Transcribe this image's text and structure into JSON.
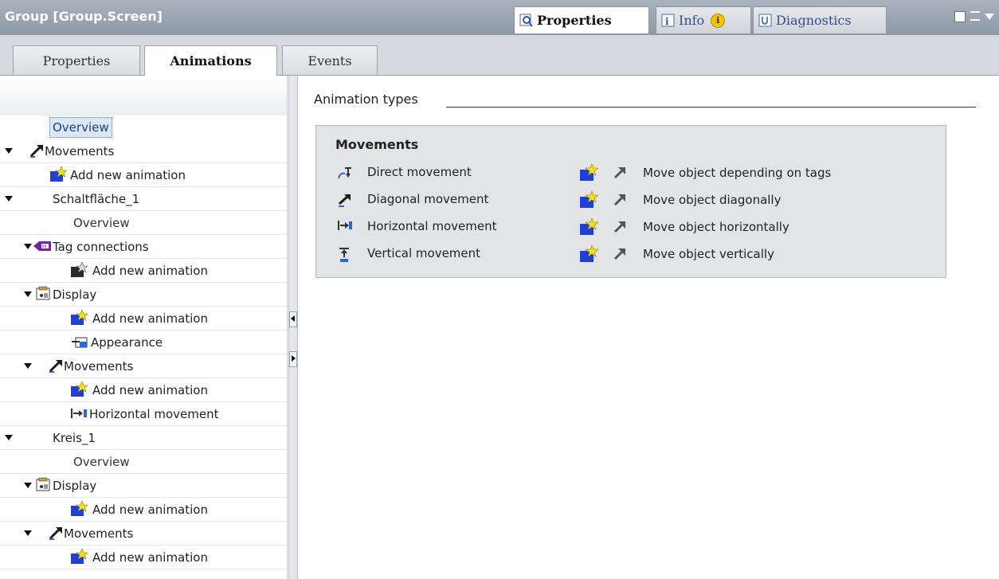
{
  "window": {
    "title": "Group [Group.Screen]",
    "tabs": [
      {
        "label": "Properties",
        "active": true
      },
      {
        "label": "Info",
        "active": false
      },
      {
        "label": "Diagnostics",
        "active": false
      }
    ]
  },
  "subtabs": [
    {
      "label": "Properties",
      "active": false
    },
    {
      "label": "Animations",
      "active": true
    },
    {
      "label": "Events",
      "active": false
    }
  ],
  "tree": {
    "items": [
      {
        "label": "Overview",
        "icon": "none",
        "level": 0,
        "selected": true
      },
      {
        "label": "Movements",
        "icon": "movement-icon",
        "level": 0,
        "expanded": true
      },
      {
        "label": "Add new animation",
        "icon": "add-animation-icon",
        "level": 1
      },
      {
        "label": "Schaltfläche_1",
        "icon": "none",
        "level": 0,
        "expanded": true
      },
      {
        "label": "Overview",
        "icon": "none",
        "level": 2
      },
      {
        "label": "Tag connections",
        "icon": "tag-connection-icon",
        "level": 1,
        "expanded": true
      },
      {
        "label": "Add new animation",
        "icon": "add-animation-icon",
        "level": 2
      },
      {
        "label": "Display",
        "icon": "display-icon",
        "level": 1,
        "expanded": true
      },
      {
        "label": "Add new animation",
        "icon": "add-animation-icon",
        "level": 2
      },
      {
        "label": "Appearance",
        "icon": "appearance-icon",
        "level": 2
      },
      {
        "label": "Movements",
        "icon": "movement-icon",
        "level": 1,
        "expanded": true
      },
      {
        "label": "Add new animation",
        "icon": "add-animation-icon",
        "level": 2
      },
      {
        "label": "Horizontal movement",
        "icon": "horizontal-movement-icon",
        "level": 2
      },
      {
        "label": "Kreis_1",
        "icon": "none",
        "level": 0,
        "expanded": true
      },
      {
        "label": "Overview",
        "icon": "none",
        "level": 2
      },
      {
        "label": "Display",
        "icon": "display-icon",
        "level": 1,
        "expanded": true
      },
      {
        "label": "Add new animation",
        "icon": "add-animation-icon",
        "level": 2
      },
      {
        "label": "Movements",
        "icon": "movement-icon",
        "level": 1,
        "expanded": true
      },
      {
        "label": "Add new animation",
        "icon": "add-animation-icon",
        "level": 2
      }
    ]
  },
  "content": {
    "section_label": "Animation types",
    "panel": {
      "title": "Movements",
      "rows": [
        {
          "label": "Direct movement",
          "icon": "direct-movement-icon",
          "action": "Move object depending on tags"
        },
        {
          "label": "Diagonal movement",
          "icon": "diagonal-movement-icon",
          "action": "Move object diagonally"
        },
        {
          "label": "Horizontal movement",
          "icon": "horizontal-movement-icon",
          "action": "Move object horizontally"
        },
        {
          "label": "Vertical movement",
          "icon": "vertical-movement-icon",
          "action": "Move object vertically"
        }
      ]
    }
  },
  "colors": {
    "titlebar": "#8d99a6",
    "selection": "#dce8f7",
    "panel": "#e3e4e6"
  }
}
